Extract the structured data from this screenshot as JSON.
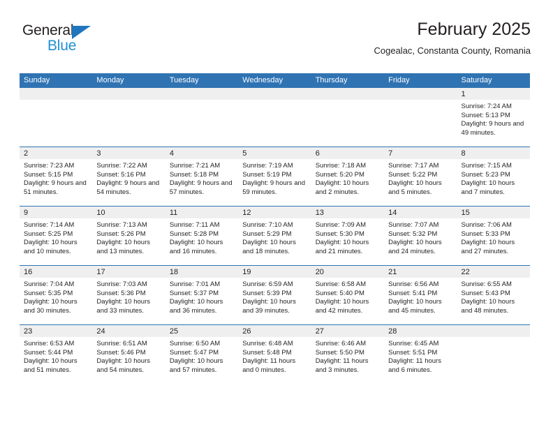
{
  "brand": {
    "name_part1": "General",
    "name_part2": "Blue",
    "flag_icon": "blue-triangle-flag",
    "accent_color": "#1f76bc",
    "accent_color_light": "#1f8fd6"
  },
  "header": {
    "title": "February 2025",
    "subtitle": "Cogealac, Constanta County, Romania"
  },
  "theme": {
    "header_bar_color": "#2f73b3",
    "daynum_band_color": "#efefef",
    "row_separator_color": "#2f73b3",
    "text_color": "#231f20"
  },
  "weekday_headers": [
    "Sunday",
    "Monday",
    "Tuesday",
    "Wednesday",
    "Thursday",
    "Friday",
    "Saturday"
  ],
  "weeks": [
    [
      {
        "day": "",
        "sunrise": "",
        "sunset": "",
        "daylight": ""
      },
      {
        "day": "",
        "sunrise": "",
        "sunset": "",
        "daylight": ""
      },
      {
        "day": "",
        "sunrise": "",
        "sunset": "",
        "daylight": ""
      },
      {
        "day": "",
        "sunrise": "",
        "sunset": "",
        "daylight": ""
      },
      {
        "day": "",
        "sunrise": "",
        "sunset": "",
        "daylight": ""
      },
      {
        "day": "",
        "sunrise": "",
        "sunset": "",
        "daylight": ""
      },
      {
        "day": "1",
        "sunrise": "Sunrise: 7:24 AM",
        "sunset": "Sunset: 5:13 PM",
        "daylight": "Daylight: 9 hours and 49 minutes."
      }
    ],
    [
      {
        "day": "2",
        "sunrise": "Sunrise: 7:23 AM",
        "sunset": "Sunset: 5:15 PM",
        "daylight": "Daylight: 9 hours and 51 minutes."
      },
      {
        "day": "3",
        "sunrise": "Sunrise: 7:22 AM",
        "sunset": "Sunset: 5:16 PM",
        "daylight": "Daylight: 9 hours and 54 minutes."
      },
      {
        "day": "4",
        "sunrise": "Sunrise: 7:21 AM",
        "sunset": "Sunset: 5:18 PM",
        "daylight": "Daylight: 9 hours and 57 minutes."
      },
      {
        "day": "5",
        "sunrise": "Sunrise: 7:19 AM",
        "sunset": "Sunset: 5:19 PM",
        "daylight": "Daylight: 9 hours and 59 minutes."
      },
      {
        "day": "6",
        "sunrise": "Sunrise: 7:18 AM",
        "sunset": "Sunset: 5:20 PM",
        "daylight": "Daylight: 10 hours and 2 minutes."
      },
      {
        "day": "7",
        "sunrise": "Sunrise: 7:17 AM",
        "sunset": "Sunset: 5:22 PM",
        "daylight": "Daylight: 10 hours and 5 minutes."
      },
      {
        "day": "8",
        "sunrise": "Sunrise: 7:15 AM",
        "sunset": "Sunset: 5:23 PM",
        "daylight": "Daylight: 10 hours and 7 minutes."
      }
    ],
    [
      {
        "day": "9",
        "sunrise": "Sunrise: 7:14 AM",
        "sunset": "Sunset: 5:25 PM",
        "daylight": "Daylight: 10 hours and 10 minutes."
      },
      {
        "day": "10",
        "sunrise": "Sunrise: 7:13 AM",
        "sunset": "Sunset: 5:26 PM",
        "daylight": "Daylight: 10 hours and 13 minutes."
      },
      {
        "day": "11",
        "sunrise": "Sunrise: 7:11 AM",
        "sunset": "Sunset: 5:28 PM",
        "daylight": "Daylight: 10 hours and 16 minutes."
      },
      {
        "day": "12",
        "sunrise": "Sunrise: 7:10 AM",
        "sunset": "Sunset: 5:29 PM",
        "daylight": "Daylight: 10 hours and 18 minutes."
      },
      {
        "day": "13",
        "sunrise": "Sunrise: 7:09 AM",
        "sunset": "Sunset: 5:30 PM",
        "daylight": "Daylight: 10 hours and 21 minutes."
      },
      {
        "day": "14",
        "sunrise": "Sunrise: 7:07 AM",
        "sunset": "Sunset: 5:32 PM",
        "daylight": "Daylight: 10 hours and 24 minutes."
      },
      {
        "day": "15",
        "sunrise": "Sunrise: 7:06 AM",
        "sunset": "Sunset: 5:33 PM",
        "daylight": "Daylight: 10 hours and 27 minutes."
      }
    ],
    [
      {
        "day": "16",
        "sunrise": "Sunrise: 7:04 AM",
        "sunset": "Sunset: 5:35 PM",
        "daylight": "Daylight: 10 hours and 30 minutes."
      },
      {
        "day": "17",
        "sunrise": "Sunrise: 7:03 AM",
        "sunset": "Sunset: 5:36 PM",
        "daylight": "Daylight: 10 hours and 33 minutes."
      },
      {
        "day": "18",
        "sunrise": "Sunrise: 7:01 AM",
        "sunset": "Sunset: 5:37 PM",
        "daylight": "Daylight: 10 hours and 36 minutes."
      },
      {
        "day": "19",
        "sunrise": "Sunrise: 6:59 AM",
        "sunset": "Sunset: 5:39 PM",
        "daylight": "Daylight: 10 hours and 39 minutes."
      },
      {
        "day": "20",
        "sunrise": "Sunrise: 6:58 AM",
        "sunset": "Sunset: 5:40 PM",
        "daylight": "Daylight: 10 hours and 42 minutes."
      },
      {
        "day": "21",
        "sunrise": "Sunrise: 6:56 AM",
        "sunset": "Sunset: 5:41 PM",
        "daylight": "Daylight: 10 hours and 45 minutes."
      },
      {
        "day": "22",
        "sunrise": "Sunrise: 6:55 AM",
        "sunset": "Sunset: 5:43 PM",
        "daylight": "Daylight: 10 hours and 48 minutes."
      }
    ],
    [
      {
        "day": "23",
        "sunrise": "Sunrise: 6:53 AM",
        "sunset": "Sunset: 5:44 PM",
        "daylight": "Daylight: 10 hours and 51 minutes."
      },
      {
        "day": "24",
        "sunrise": "Sunrise: 6:51 AM",
        "sunset": "Sunset: 5:46 PM",
        "daylight": "Daylight: 10 hours and 54 minutes."
      },
      {
        "day": "25",
        "sunrise": "Sunrise: 6:50 AM",
        "sunset": "Sunset: 5:47 PM",
        "daylight": "Daylight: 10 hours and 57 minutes."
      },
      {
        "day": "26",
        "sunrise": "Sunrise: 6:48 AM",
        "sunset": "Sunset: 5:48 PM",
        "daylight": "Daylight: 11 hours and 0 minutes."
      },
      {
        "day": "27",
        "sunrise": "Sunrise: 6:46 AM",
        "sunset": "Sunset: 5:50 PM",
        "daylight": "Daylight: 11 hours and 3 minutes."
      },
      {
        "day": "28",
        "sunrise": "Sunrise: 6:45 AM",
        "sunset": "Sunset: 5:51 PM",
        "daylight": "Daylight: 11 hours and 6 minutes."
      },
      {
        "day": "",
        "sunrise": "",
        "sunset": "",
        "daylight": ""
      }
    ]
  ]
}
